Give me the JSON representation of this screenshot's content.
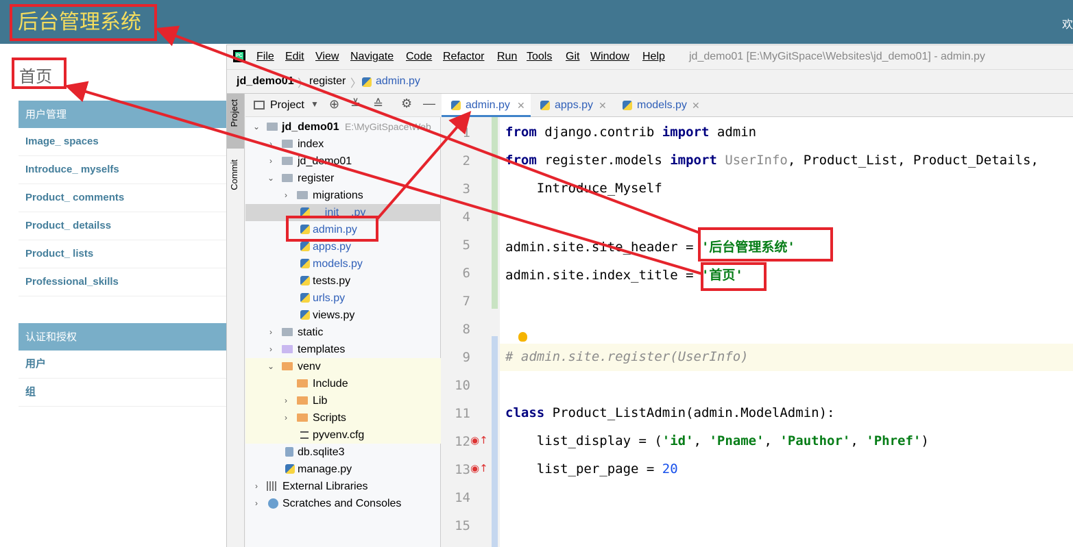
{
  "admin": {
    "site_title": "后台管理系统",
    "welcome": "欢",
    "index_title": "首页",
    "modules": [
      {
        "caption": "用户管理",
        "rows": [
          "Image_ spaces",
          "Introduce_ myselfs",
          "Product_ comments",
          "Product_ detailss",
          "Product_ lists",
          "Professional_skills"
        ]
      },
      {
        "caption": "认证和授权",
        "rows": [
          "用户",
          "组"
        ]
      }
    ]
  },
  "ide": {
    "menu": [
      "File",
      "Edit",
      "View",
      "Navigate",
      "Code",
      "Refactor",
      "Run",
      "Tools",
      "Git",
      "Window",
      "Help"
    ],
    "window_title": "jd_demo01 [E:\\MyGitSpace\\Websites\\jd_demo01] - admin.py",
    "breadcrumbs": [
      "jd_demo01",
      "register",
      "admin.py"
    ],
    "side_tabs": [
      "Project",
      "Commit"
    ],
    "project_label": "Project",
    "tree": [
      {
        "label": "jd_demo01",
        "path": "E:\\MyGitSpace\\Web"
      },
      {
        "label": "index"
      },
      {
        "label": "jd_demo01"
      },
      {
        "label": "register"
      },
      {
        "label": "migrations"
      },
      {
        "label": "__init__.py"
      },
      {
        "label": "admin.py"
      },
      {
        "label": "apps.py"
      },
      {
        "label": "models.py"
      },
      {
        "label": "tests.py"
      },
      {
        "label": "urls.py"
      },
      {
        "label": "views.py"
      },
      {
        "label": "static"
      },
      {
        "label": "templates"
      },
      {
        "label": "venv"
      },
      {
        "label": "Include"
      },
      {
        "label": "Lib"
      },
      {
        "label": "Scripts"
      },
      {
        "label": "pyvenv.cfg"
      },
      {
        "label": "db.sqlite3"
      },
      {
        "label": "manage.py"
      },
      {
        "label": "External Libraries"
      },
      {
        "label": "Scratches and Consoles"
      }
    ],
    "tabs": [
      "admin.py",
      "apps.py",
      "models.py"
    ],
    "line_numbers": [
      "1",
      "2",
      "3",
      "4",
      "5",
      "6",
      "7",
      "8",
      "9",
      "10",
      "11",
      "12",
      "13",
      "14",
      "15"
    ],
    "code": {
      "l1_kw1": "from",
      "l1_mod": " django.contrib ",
      "l1_kw2": "import",
      "l1_name": " admin",
      "l2_kw1": "from",
      "l2_mod": " register.models ",
      "l2_kw2": "import",
      "l2_gray": " UserInfo",
      "l2_rest": ", Product_List, Product_Details,",
      "l3": "    Introduce_Myself",
      "l5_a": "admin.site.site_header = ",
      "l5_str": "'后台管理系统'",
      "l6_a": "admin.site.index_title = ",
      "l6_str": "'首页'",
      "l9": "# admin.site.register(UserInfo)",
      "l11_kw": "class",
      "l11_rest": " Product_ListAdmin(admin.ModelAdmin):",
      "l12_a": "    list_display = (",
      "l12_s1": "'id'",
      "l12_c1": ", ",
      "l12_s2": "'Pname'",
      "l12_c2": ", ",
      "l12_s3": "'Pauthor'",
      "l12_c3": ", ",
      "l12_s4": "'Phref'",
      "l12_e": ")",
      "l13_a": "    list_per_page = ",
      "l13_num": "20"
    }
  },
  "colors": {
    "admin_header": "#417690",
    "title_yellow": "#f5dd5d",
    "module_caption": "#79aec8",
    "annotation_red": "#e5242c"
  }
}
